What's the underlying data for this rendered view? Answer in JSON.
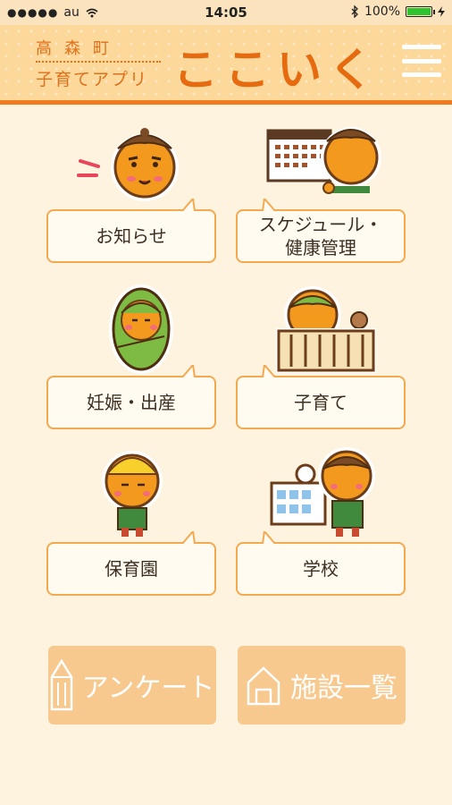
{
  "status_bar": {
    "signal": "●●●●●",
    "carrier": "au",
    "time": "14:05",
    "battery": "100%",
    "battery_level": 1.0
  },
  "header": {
    "town": "高森町",
    "subtitle": "子育てアプリ",
    "logo": "ここいく",
    "menu_icon": "hamburger-menu-icon"
  },
  "menu_items": [
    {
      "label": "お知らせ",
      "icon": "notice-character-icon"
    },
    {
      "label": "スケジュール・\n健康管理",
      "icon": "calendar-character-icon"
    },
    {
      "label": "妊娠・出産",
      "icon": "baby-character-icon"
    },
    {
      "label": "子育て",
      "icon": "crib-character-icon"
    },
    {
      "label": "保育園",
      "icon": "nursery-character-icon"
    },
    {
      "label": "学校",
      "icon": "school-character-icon"
    }
  ],
  "buttons": {
    "survey": {
      "label": "アンケート",
      "icon": "pencil-icon"
    },
    "facilities": {
      "label": "施設一覧",
      "icon": "house-icon"
    }
  },
  "colors": {
    "accent": "#e66a10",
    "header_bg": "#fcd99a",
    "page_bg": "#fdf3df",
    "button_bg": "#f7c98e"
  }
}
